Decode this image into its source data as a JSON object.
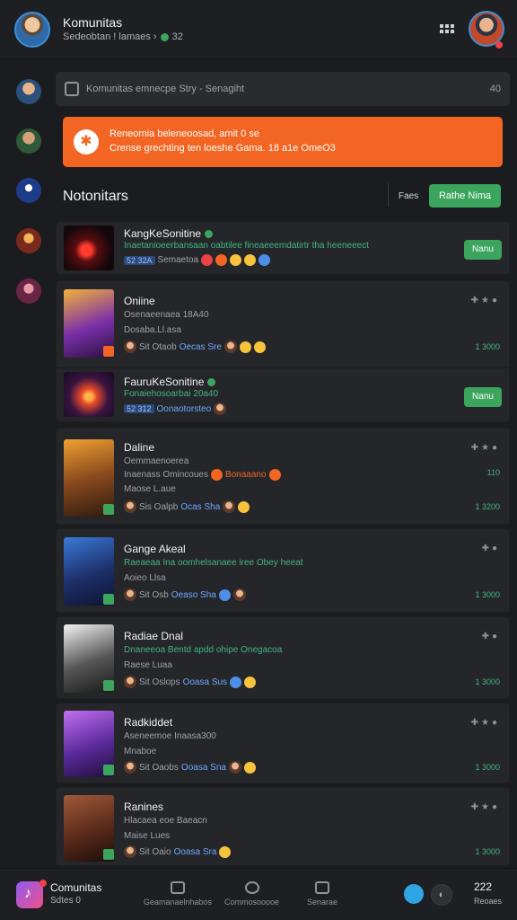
{
  "header": {
    "title": "Komunitas",
    "subtitle": "Sedeobtan ! lamaes ›",
    "online_count": "32"
  },
  "search": {
    "placeholder": "Komunitas emnecpe Stry - Senagiht",
    "right_label": "40"
  },
  "banner": {
    "line1": "Reneomia beleneoosad, amit 0 se",
    "line2": "Crense grechting ten loeshe Gama. 18 a1e OmeO3"
  },
  "section": {
    "title": "Notonitars",
    "link": "Faes",
    "button": "Rathe Nima"
  },
  "rows": [
    {
      "title": "KangKeSonitine",
      "green": "Inaetanioeerbansaan oabtilee fineaeeemdatirtr tha heeneeect",
      "meta_chip1": "52 32A",
      "meta_text": "Semaetoa",
      "button": "Nanu"
    },
    {
      "title": "Oniine",
      "muted1": "Osenaeenaea 18A40",
      "muted2": "Dosaba.Ll.asa",
      "meta_name": "Sit Otaob",
      "meta_hl": "Oecas Sre",
      "count": "1 3000"
    },
    {
      "title": "FauruKeSonitine",
      "green": "Fonaiehosoarbai 20a40",
      "meta_chip1": "52 312",
      "meta_text": "Oonaotorsteo",
      "button": "Nanu"
    },
    {
      "title": "Daline",
      "muted1": "Oemmaenoerea",
      "muted2": "Inaenass Omincoues",
      "tag": "Bonaaano",
      "muted3": "Maose L.aue",
      "meta_name": "Sis Oalpb",
      "meta_hl": "Ocas Sha",
      "count_top": "110",
      "count": "1 3200"
    },
    {
      "title": "Gange Akeal",
      "green": "Raeaeaa Ina oomhelsanaee iree Obey heeat",
      "muted2": "Aoieo Llsa",
      "meta_name": "Sit Osb",
      "meta_hl": "Oeaso Sha",
      "count": "1 3000"
    },
    {
      "title": "Radiae Dnal",
      "green": "Dnaneeoa Bentd apdd ohipe Onegacoa",
      "muted2": "Raese Luaa",
      "meta_name": "Sit Oslops",
      "meta_hl": "Ooasa Sus",
      "count": "1 3000"
    },
    {
      "title": "Radkiddet",
      "muted1": "Aseneemoe Inaasa300",
      "muted2": "Mnaboe",
      "meta_name": "Sit Oaobs",
      "meta_hl": "Ooasa Sna",
      "count": "1 3000"
    },
    {
      "title": "Ranines",
      "muted1": "Hlacaea eoe Baeacn",
      "muted2": "Maise Lues",
      "meta_name": "Sit Oaio",
      "meta_hl": "Ooasa Sra",
      "count": "1 3000"
    }
  ],
  "bottom": {
    "title": "Comunitas",
    "subtitle": "Sdtes 0",
    "nav1": "Geamanaelnhabos",
    "nav2": "Commosooooe",
    "nav3": "Senarae",
    "count": "222",
    "count_label": "Reoaes"
  },
  "colors": {
    "accent_orange": "#f26522",
    "accent_green": "#3ba55d",
    "background": "#1b1c1f"
  }
}
